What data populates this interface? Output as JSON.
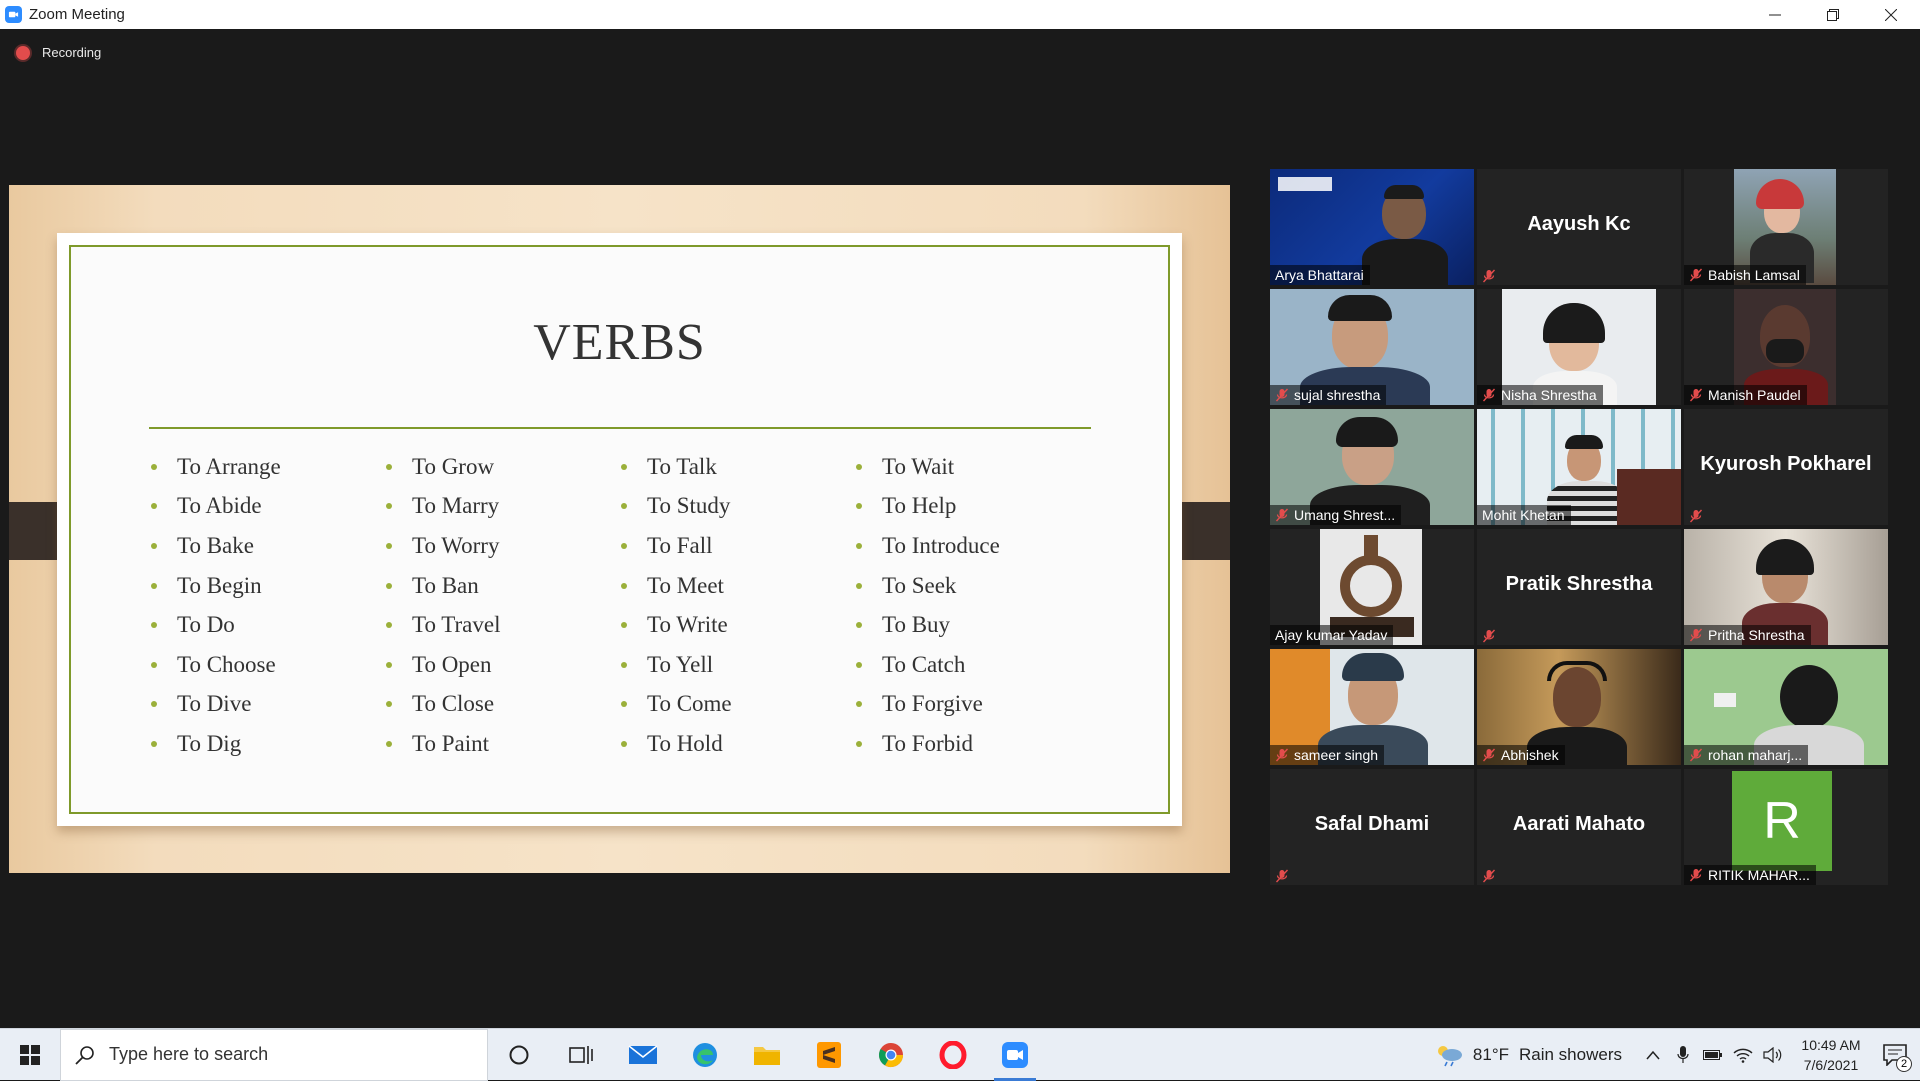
{
  "window": {
    "title": "Zoom Meeting"
  },
  "recording": {
    "label": "Recording"
  },
  "slide": {
    "title": "VERBS",
    "columns": [
      [
        "To Arrange",
        "To Abide",
        "To Bake",
        "To Begin",
        "To Do",
        "To Choose",
        "To Dive",
        "To Dig"
      ],
      [
        "To Grow",
        "To Marry",
        "To Worry",
        "To Ban",
        "To Travel",
        "To Open",
        "To Close",
        "To Paint"
      ],
      [
        "To Talk",
        "To Study",
        "To Fall",
        "To Meet",
        "To Write",
        "To Yell",
        "To Come",
        "To Hold"
      ],
      [
        "To Wait",
        "To Help",
        "To Introduce",
        "To Seek",
        "To Buy",
        "To Catch",
        "To Forgive",
        "To Forbid"
      ]
    ]
  },
  "participants": [
    {
      "name": "Arya Bhattarai",
      "video": true,
      "active": true,
      "muted": false,
      "scene": "westcliff"
    },
    {
      "name": "Aayush Kc",
      "video": false,
      "muted": true
    },
    {
      "name": "Babish Lamsal",
      "video": true,
      "muted": true,
      "scene": "portrait-red"
    },
    {
      "name": "sujal shrestha",
      "video": true,
      "muted": true,
      "scene": "man-blue"
    },
    {
      "name": "Nisha Shrestha",
      "video": true,
      "muted": true,
      "scene": "woman-glasses"
    },
    {
      "name": "Manish Paudel",
      "video": true,
      "muted": true,
      "scene": "mask"
    },
    {
      "name": "Umang Shrest...",
      "video": true,
      "muted": true,
      "scene": "man-green"
    },
    {
      "name": "Mohit Khetan",
      "video": true,
      "muted": false,
      "scene": "curtain"
    },
    {
      "name": "Kyurosh Pokharel",
      "video": false,
      "muted": true
    },
    {
      "name": "Ajay kumar Yadav",
      "video": true,
      "muted": false,
      "scene": "object"
    },
    {
      "name": "Pratik Shrestha",
      "video": false,
      "muted": true
    },
    {
      "name": "Pritha Shrestha",
      "video": true,
      "muted": true,
      "scene": "woman-room"
    },
    {
      "name": "sameer singh",
      "video": true,
      "muted": true,
      "scene": "man-orange"
    },
    {
      "name": "Abhishek",
      "video": true,
      "muted": true,
      "scene": "headphones"
    },
    {
      "name": "rohan maharj...",
      "video": true,
      "muted": true,
      "scene": "green-wall"
    },
    {
      "name": "Safal Dhami",
      "video": false,
      "muted": true
    },
    {
      "name": "Aarati Mahato",
      "video": false,
      "muted": true
    },
    {
      "name": "RITIK MAHAR...",
      "video": false,
      "muted": true,
      "avatar_letter": "R",
      "avatar_color": "#5fab3a"
    }
  ],
  "taskbar": {
    "search_placeholder": "Type here to search",
    "weather": {
      "temp": "81°F",
      "condition": "Rain showers"
    },
    "time": "10:49 AM",
    "date": "7/6/2021",
    "notifications": "2",
    "pinned": [
      "task-view-icon",
      "mail-icon",
      "edge-icon",
      "file-explorer-icon",
      "sublime-icon",
      "chrome-icon",
      "opera-icon",
      "zoom-icon"
    ]
  },
  "colors": {
    "accent_green": "#7f9a2b",
    "active_speaker": "#d7e34a",
    "zoom_blue": "#2d8cff",
    "mute_red": "#e24c4c"
  }
}
